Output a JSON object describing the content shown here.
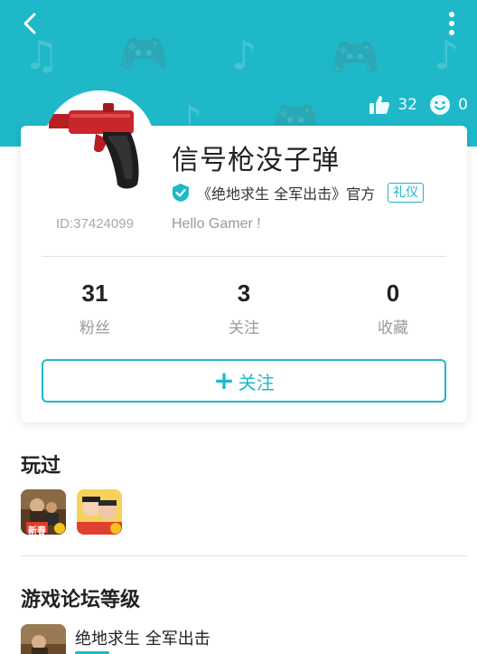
{
  "header": {
    "likes_count": "32",
    "smiles_count": "0",
    "accent_color": "#1fb8c9"
  },
  "profile": {
    "username": "信号枪没子弹",
    "user_id": "ID:37424099",
    "verify_text": "《绝地求生 全军出击》官方",
    "badge_label": "礼仪",
    "bio": "Hello Gamer !"
  },
  "stats": [
    {
      "value": "31",
      "label": "粉丝"
    },
    {
      "value": "3",
      "label": "关注"
    },
    {
      "value": "0",
      "label": "收藏"
    }
  ],
  "follow_button": {
    "label": "关注"
  },
  "played": {
    "title": "玩过",
    "games": [
      {
        "name": "game-1",
        "badge": "新春"
      },
      {
        "name": "game-2",
        "badge": ""
      }
    ]
  },
  "forum_level": {
    "title": "游戏论坛等级",
    "game_name": "绝地求生 全军出击"
  }
}
